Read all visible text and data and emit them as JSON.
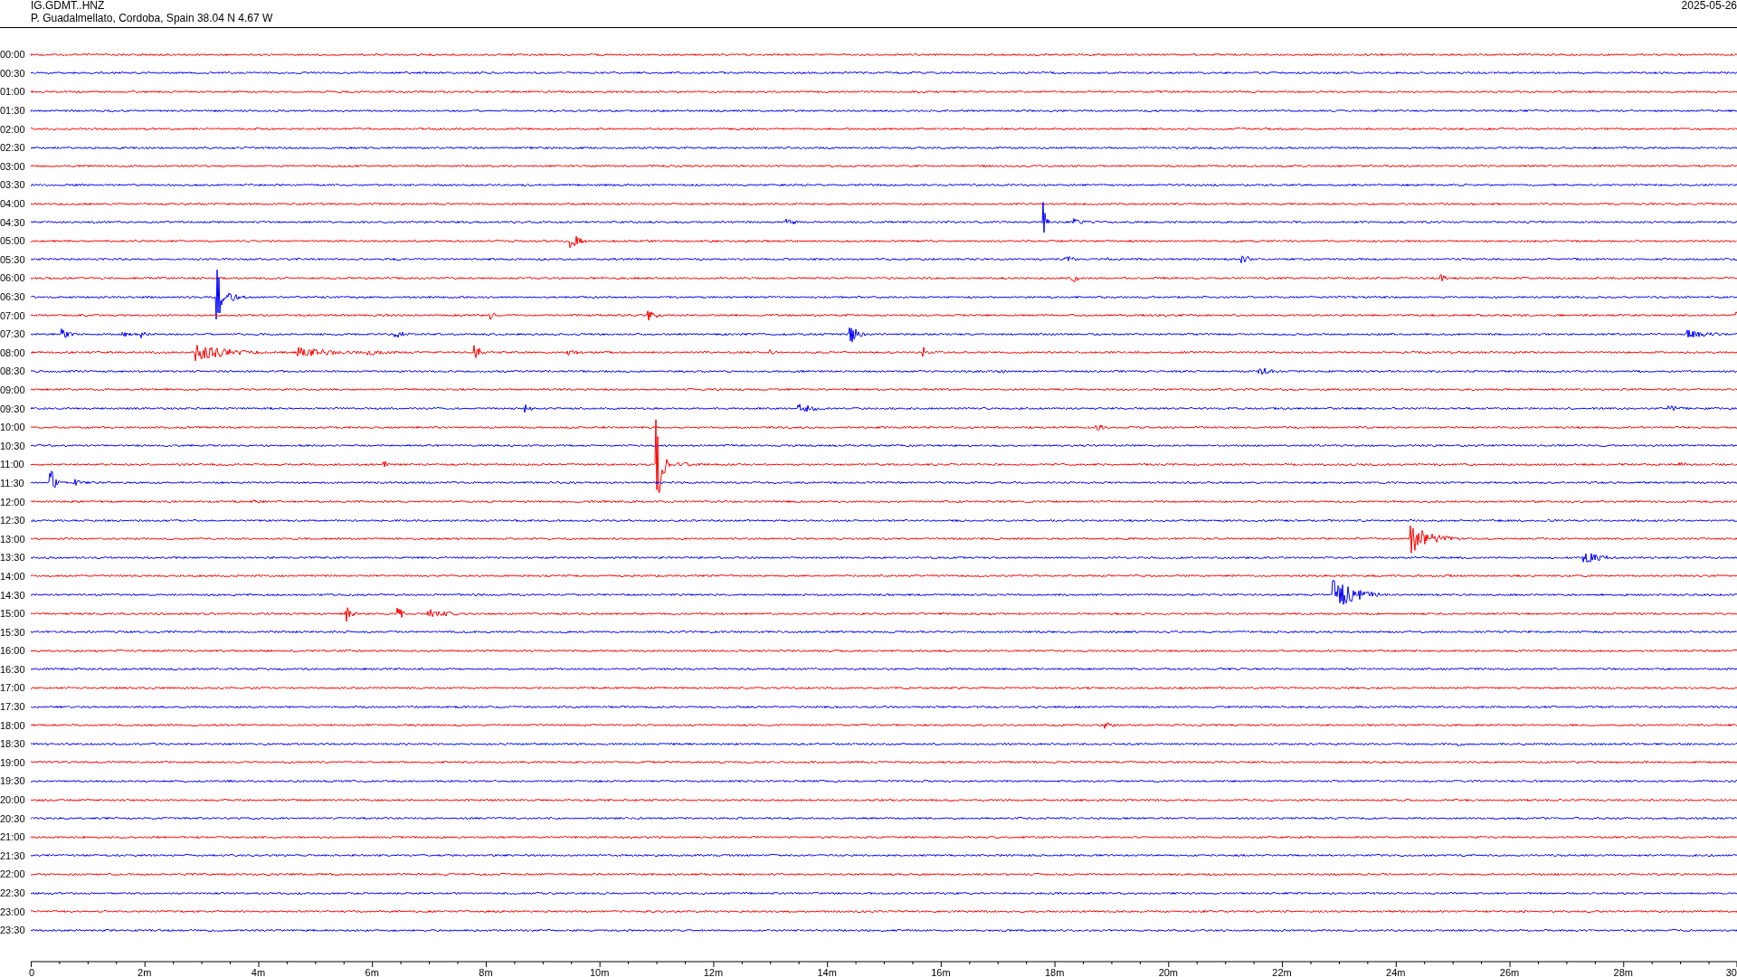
{
  "station": {
    "code": "IG.GDMT..HNZ",
    "location": "P. Guadalmellato, Cordoba, Spain  38.04 N 4.67 W",
    "date": "2025-05-26"
  },
  "traces": [
    {
      "time": "00:00",
      "color": "#ff0000"
    },
    {
      "time": "00:30",
      "color": "#0000ff"
    },
    {
      "time": "01:00",
      "color": "#ff0000"
    },
    {
      "time": "01:30",
      "color": "#0000ff"
    },
    {
      "time": "02:00",
      "color": "#ff0000"
    },
    {
      "time": "02:30",
      "color": "#0000ff"
    },
    {
      "time": "03:00",
      "color": "#ff0000"
    },
    {
      "time": "03:30",
      "color": "#0000ff"
    },
    {
      "time": "04:00",
      "color": "#ff0000"
    },
    {
      "time": "04:30",
      "color": "#0000ff"
    },
    {
      "time": "05:00",
      "color": "#ff0000"
    },
    {
      "time": "05:30",
      "color": "#0000ff"
    },
    {
      "time": "06:00",
      "color": "#ff0000"
    },
    {
      "time": "06:30",
      "color": "#0000ff"
    },
    {
      "time": "07:00",
      "color": "#ff0000"
    },
    {
      "time": "07:30",
      "color": "#0000ff"
    },
    {
      "time": "08:00",
      "color": "#ff0000"
    },
    {
      "time": "08:30",
      "color": "#0000ff"
    },
    {
      "time": "09:00",
      "color": "#ff0000"
    },
    {
      "time": "09:30",
      "color": "#0000ff"
    },
    {
      "time": "10:00",
      "color": "#ff0000"
    },
    {
      "time": "10:30",
      "color": "#0000ff"
    },
    {
      "time": "11:00",
      "color": "#ff0000"
    },
    {
      "time": "11:30",
      "color": "#0000ff"
    },
    {
      "time": "12:00",
      "color": "#ff0000"
    },
    {
      "time": "12:30",
      "color": "#0000ff"
    },
    {
      "time": "13:00",
      "color": "#ff0000"
    },
    {
      "time": "13:30",
      "color": "#0000ff"
    },
    {
      "time": "14:00",
      "color": "#ff0000"
    },
    {
      "time": "14:30",
      "color": "#0000ff"
    },
    {
      "time": "15:00",
      "color": "#ff0000"
    },
    {
      "time": "15:30",
      "color": "#0000ff"
    },
    {
      "time": "16:00",
      "color": "#ff0000"
    },
    {
      "time": "16:30",
      "color": "#0000ff"
    },
    {
      "time": "17:00",
      "color": "#ff0000"
    },
    {
      "time": "17:30",
      "color": "#0000ff"
    },
    {
      "time": "18:00",
      "color": "#ff0000"
    },
    {
      "time": "18:30",
      "color": "#0000ff"
    },
    {
      "time": "19:00",
      "color": "#ff0000"
    },
    {
      "time": "19:30",
      "color": "#0000ff"
    },
    {
      "time": "20:00",
      "color": "#ff0000"
    },
    {
      "time": "20:30",
      "color": "#0000ff"
    },
    {
      "time": "21:00",
      "color": "#ff0000"
    },
    {
      "time": "21:30",
      "color": "#0000ff"
    },
    {
      "time": "22:00",
      "color": "#ff0000"
    },
    {
      "time": "22:30",
      "color": "#0000ff"
    },
    {
      "time": "23:00",
      "color": "#ff0000"
    },
    {
      "time": "23:30",
      "color": "#0000ff"
    }
  ],
  "time_axis": [
    "0",
    "2m",
    "4m",
    "6m",
    "8m",
    "10m",
    "12m",
    "14m",
    "16m",
    "18m",
    "20m",
    "22m",
    "24m",
    "26m",
    "28m",
    "30"
  ]
}
